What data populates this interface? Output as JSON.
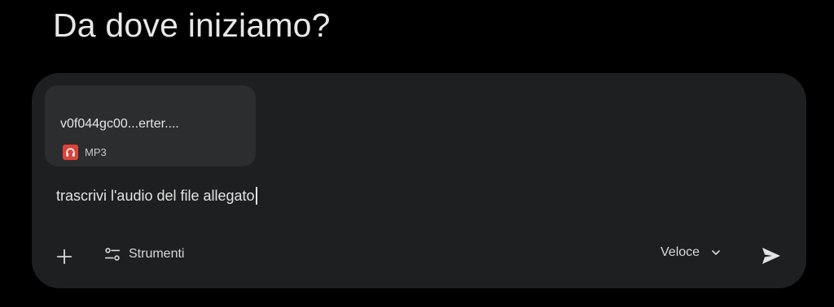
{
  "header": {
    "title": "Da dove iniziamo?"
  },
  "composer": {
    "attachment": {
      "file_name": "v0f044gc00...erter....",
      "file_type": "MP3",
      "icon": "headphones-icon",
      "icon_color": "#d9443a"
    },
    "input_text": "trascrivi l'audio del file allegato",
    "toolbar": {
      "add_icon": "plus-icon",
      "tools_icon": "tune-icon",
      "tools_label": "Strumenti",
      "model_label": "Veloce",
      "model_chevron": "chevron-down-icon",
      "send_icon": "send-icon"
    }
  },
  "colors": {
    "background": "#000000",
    "composer": "#1e1f20",
    "attachment_card": "#2c2d2f"
  }
}
